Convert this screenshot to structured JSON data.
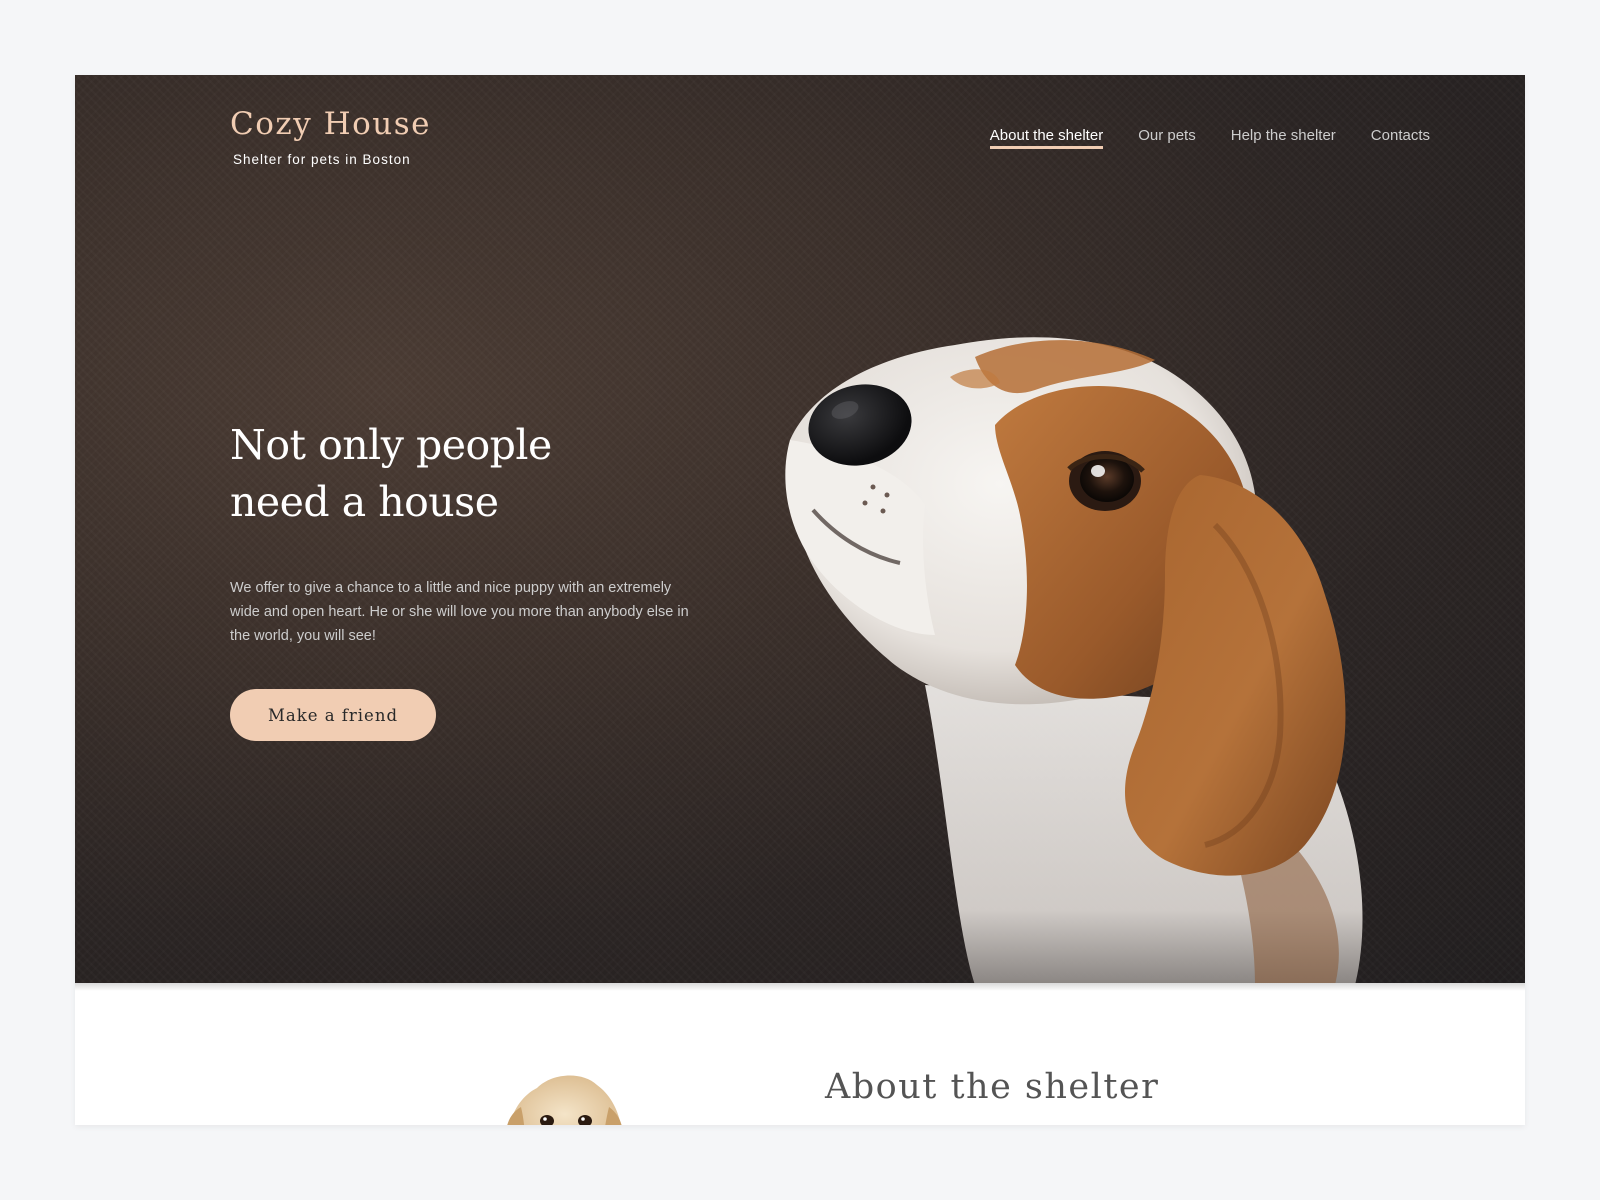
{
  "header": {
    "logo_title": "Cozy House",
    "logo_subtitle": "Shelter for pets in Boston"
  },
  "nav": {
    "items": [
      {
        "label": "About the shelter",
        "active": true
      },
      {
        "label": "Our pets",
        "active": false
      },
      {
        "label": "Help the shelter",
        "active": false
      },
      {
        "label": "Contacts",
        "active": false
      }
    ]
  },
  "hero": {
    "title_line1": "Not only people",
    "title_line2": "need a house",
    "text": "We offer to give a chance to a little and nice puppy with an extremely wide and open heart. He or she will love you more than anybody else in the world, you will see!",
    "cta_label": "Make a friend",
    "image_subject": "beagle-puppy"
  },
  "about": {
    "title": "About the shelter",
    "image_subject": "golden-retriever-puppy"
  },
  "colors": {
    "accent": "#f1cdb3",
    "hero_dark": "#211e1f",
    "hero_warm": "#4a3b33",
    "heading_grey": "#545454",
    "page_bg": "#f5f6f8"
  }
}
